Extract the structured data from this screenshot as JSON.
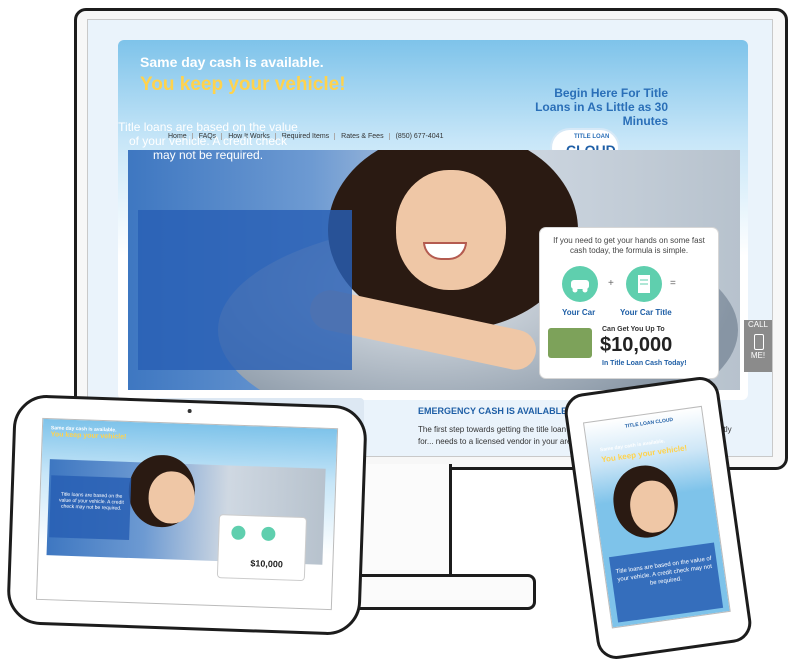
{
  "desktop": {
    "tagline_line1": "Same day cash is available.",
    "tagline_line2": "You keep your vehicle!",
    "begin_text": "Begin Here For Title Loans in As Little as 30 Minutes",
    "nav": [
      "Home",
      "FAQs",
      "How It Works",
      "Required Items",
      "Rates & Fees",
      "(850) 677-4041"
    ],
    "logo_top": "TITLE LOAN",
    "logo_main": "CLOUD",
    "hero_text": "Title loans are based on the value of your vehicle. A credit check may not be required.",
    "formula": {
      "intro": "If you need to get your hands on some fast cash today, the formula is simple.",
      "plus": "+",
      "equals": "=",
      "item1": "Your Car",
      "item2": "Your Car Title",
      "upto": "Can Get You Up To",
      "amount": "$10,000",
      "sub": "In Title Loan Cash Today!"
    },
    "call_label_top": "CALL",
    "call_label_bottom": "ME!",
    "emergency_title": "EMERGENCY CASH IS AVAILABLE TODAY",
    "emergency_text": "The first step towards getting the title loan y... title loan request form. This would instantly for... needs to a licensed vendor in your area who has..."
  },
  "tablet": {
    "line1": "Same day cash is available.",
    "line2": "You keep your vehicle!",
    "hero_text": "Title loans are based on the value of your vehicle. A credit check may not be required.",
    "amount": "$10,000"
  },
  "phone": {
    "logo": "TITLE LOAN CLOUD",
    "line1": "Same day cash is available.",
    "line2": "You keep your vehicle!",
    "hero_text": "Title loans are based on the value of your vehicle. A credit check may not be required."
  }
}
